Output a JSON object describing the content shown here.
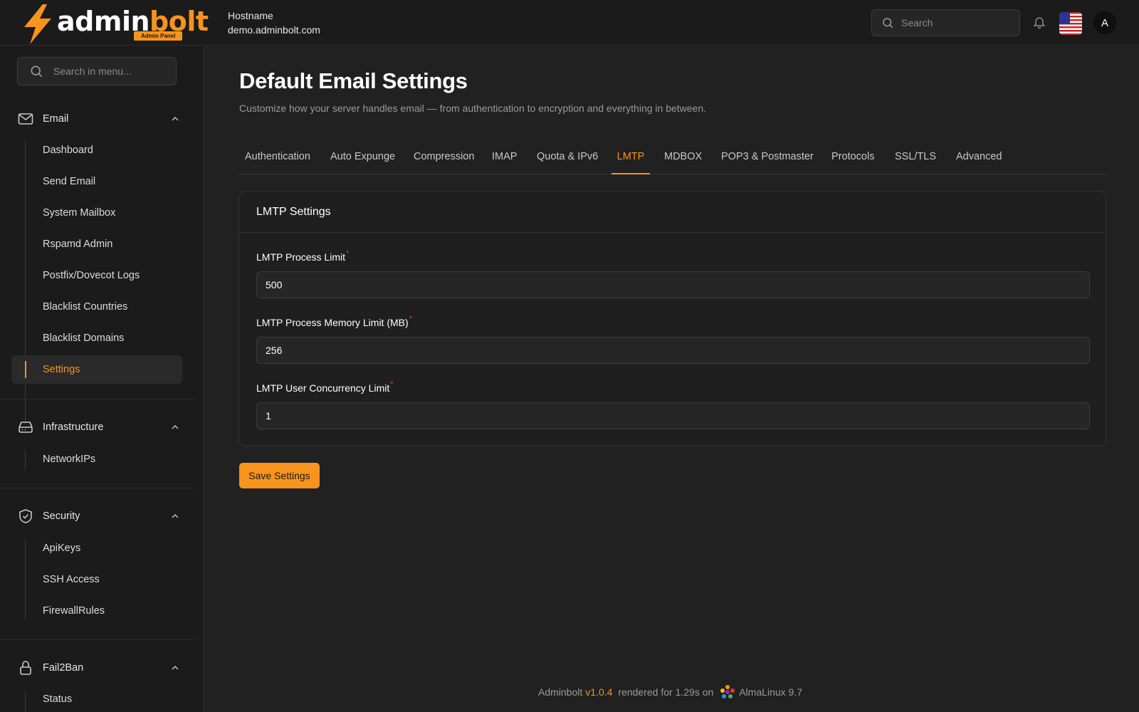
{
  "brand": {
    "name_part1": "admin",
    "name_part2": "bolt",
    "badge": "Admin Panel",
    "accent": "#f7941d"
  },
  "header": {
    "hostname_label": "Hostname",
    "hostname_value": "demo.adminbolt.com",
    "search_placeholder": "Search",
    "avatar_initial": "A",
    "icons": [
      "search-icon",
      "bell-icon",
      "us-flag-icon"
    ]
  },
  "sidebar": {
    "search_placeholder": "Search in menu...",
    "groups": [
      {
        "label": "Email",
        "icon": "mail-icon",
        "items": [
          {
            "label": "Dashboard"
          },
          {
            "label": "Send Email"
          },
          {
            "label": "System Mailbox"
          },
          {
            "label": "Rspamd Admin"
          },
          {
            "label": "Postfix/Dovecot Logs"
          },
          {
            "label": "Blacklist Countries"
          },
          {
            "label": "Blacklist Domains"
          },
          {
            "label": "Settings",
            "active": true
          }
        ]
      },
      {
        "label": "Infrastructure",
        "icon": "server-icon",
        "items": [
          {
            "label": "NetworkIPs"
          }
        ]
      },
      {
        "label": "Security",
        "icon": "shield-check-icon",
        "items": [
          {
            "label": "ApiKeys"
          },
          {
            "label": "SSH Access"
          },
          {
            "label": "FirewallRules"
          }
        ]
      },
      {
        "label": "Fail2Ban",
        "icon": "lock-icon",
        "items": [
          {
            "label": "Status"
          }
        ]
      }
    ]
  },
  "main": {
    "title": "Default Email Settings",
    "subtitle": "Customize how your server handles email — from authentication to encryption and everything in between.",
    "tabs": [
      {
        "label": "Authentication"
      },
      {
        "label": "Auto Expunge"
      },
      {
        "label": "Compression"
      },
      {
        "label": "IMAP"
      },
      {
        "label": "Quota & IPv6"
      },
      {
        "label": "LMTP",
        "active": true
      },
      {
        "label": "MDBOX"
      },
      {
        "label": "POP3 & Postmaster"
      },
      {
        "label": "Protocols"
      },
      {
        "label": "SSL/TLS"
      },
      {
        "label": "Advanced"
      }
    ],
    "card": {
      "title": "LMTP Settings",
      "fields": [
        {
          "label": "LMTP Process Limit",
          "required_mark": "*",
          "value": "500"
        },
        {
          "label": "LMTP Process Memory Limit (MB)",
          "required_mark": "*",
          "value": "256"
        },
        {
          "label": "LMTP User Concurrency Limit",
          "required_mark": "*",
          "value": "1"
        }
      ]
    },
    "save_label": "Save Settings"
  },
  "footer": {
    "app": "Adminbolt",
    "version": "v1.0.4",
    "rendered_text": "rendered for 1.29s on",
    "os": "AlmaLinux 9.7"
  }
}
